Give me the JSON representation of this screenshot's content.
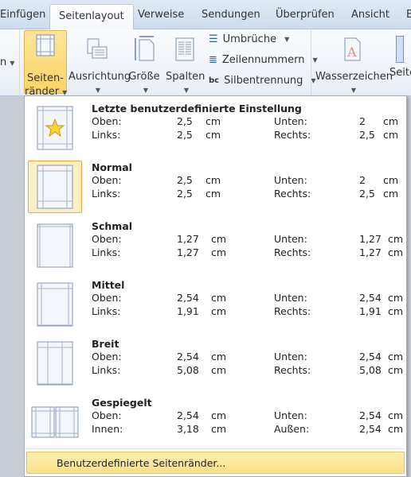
{
  "tabs": [
    "Einfügen",
    "Seitenlayout",
    "Verweise",
    "Sendungen",
    "Überprüfen",
    "Ansicht",
    "E"
  ],
  "active_tab": "Seitenlayout",
  "ribbon": {
    "left_cut_label": "n",
    "seitenraender": {
      "line1": "Seiten-",
      "line2": "ränder"
    },
    "ausrichtung": "Ausrichtung",
    "groesse": "Größe",
    "spalten": "Spalten",
    "umbrueche": "Umbrüche",
    "zeilennummern": "Zeilennummern",
    "silbentrennung": "Silbentrennung",
    "wasserzeichen": "Wasserzeichen",
    "seite_cut": "Seite"
  },
  "menu": {
    "items": [
      {
        "title": "Letzte benutzerdefinierte Einstellung",
        "icon": "last-custom",
        "l1": "Oben:",
        "v1": "2,5",
        "l2": "Unten:",
        "v2": "2",
        "l3": "Links:",
        "v3": "2,5",
        "l4": "Rechts:",
        "v4": "2,5",
        "unit": "cm"
      },
      {
        "title": "Normal",
        "icon": "normal",
        "selected": true,
        "l1": "Oben:",
        "v1": "2,5",
        "l2": "Unten:",
        "v2": "2",
        "l3": "Links:",
        "v3": "2,5",
        "l4": "Rechts:",
        "v4": "2,5",
        "unit": "cm"
      },
      {
        "title": "Schmal",
        "icon": "narrow",
        "l1": "Oben:",
        "v1": "1,27",
        "l2": "Unten:",
        "v2": "1,27",
        "l3": "Links:",
        "v3": "1,27",
        "l4": "Rechts:",
        "v4": "1,27",
        "unit": "cm"
      },
      {
        "title": "Mittel",
        "icon": "moderate",
        "l1": "Oben:",
        "v1": "2,54",
        "l2": "Unten:",
        "v2": "2,54",
        "l3": "Links:",
        "v3": "1,91",
        "l4": "Rechts:",
        "v4": "1,91",
        "unit": "cm"
      },
      {
        "title": "Breit",
        "icon": "wide",
        "l1": "Oben:",
        "v1": "2,54",
        "l2": "Unten:",
        "v2": "2,54",
        "l3": "Links:",
        "v3": "5,08",
        "l4": "Rechts:",
        "v4": "5,08",
        "unit": "cm"
      },
      {
        "title": "Gespiegelt",
        "icon": "mirrored",
        "l1": "Oben:",
        "v1": "2,54",
        "l2": "Unten:",
        "v2": "2,54",
        "l3": "Innen:",
        "v3": "3,18",
        "l4": "Außen:",
        "v4": "2,54",
        "unit": "cm"
      }
    ],
    "footer": "Benutzerdefinierte Seitenränder..."
  }
}
